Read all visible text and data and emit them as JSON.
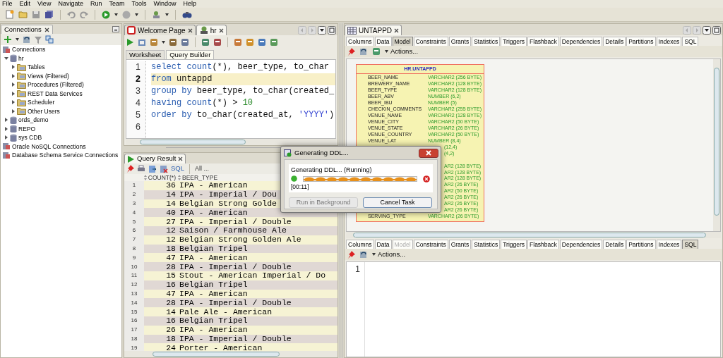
{
  "menu": [
    "File",
    "Edit",
    "View",
    "Navigate",
    "Run",
    "Team",
    "Tools",
    "Window",
    "Help"
  ],
  "connections_panel": {
    "tab": "Connections",
    "tree": [
      {
        "label": "Connections",
        "kind": "group"
      },
      {
        "label": "hr",
        "kind": "connection",
        "expanded": true,
        "children": [
          {
            "label": "Tables",
            "kind": "folder",
            "expanded": false
          },
          {
            "label": "Views (Filtered)",
            "kind": "folder",
            "expanded": false
          },
          {
            "label": "Procedures (Filtered)",
            "kind": "folder",
            "expanded": false
          },
          {
            "label": "REST Data Services",
            "kind": "folder",
            "expanded": false
          },
          {
            "label": "Scheduler",
            "kind": "folder",
            "expanded": false
          },
          {
            "label": "Other Users",
            "kind": "folder",
            "expanded": false
          }
        ]
      },
      {
        "label": "ords_demo",
        "kind": "connection",
        "expanded": false
      },
      {
        "label": "REPO",
        "kind": "connection",
        "expanded": false
      },
      {
        "label": "sys CDB",
        "kind": "connection",
        "expanded": false
      },
      {
        "label": "Oracle NoSQL Connections",
        "kind": "group"
      },
      {
        "label": "Database Schema Service Connections",
        "kind": "group"
      }
    ]
  },
  "editor": {
    "tabs": [
      {
        "label": "Welcome Page",
        "selected": false
      },
      {
        "label": "hr",
        "selected": true
      }
    ],
    "sheet_tabs": [
      {
        "label": "Worksheet",
        "selected": true
      },
      {
        "label": "Query Builder",
        "selected": false
      }
    ],
    "lines": [
      {
        "number": "1",
        "current": false,
        "tokens": [
          {
            "t": "select count",
            "kind": "keyword"
          },
          {
            "t": "(*), beer_type, to_char",
            "kind": "plain"
          }
        ]
      },
      {
        "number": "2",
        "current": true,
        "tokens": [
          {
            "t": "from",
            "kind": "keyword"
          },
          {
            "t": " untappd",
            "kind": "plain"
          }
        ]
      },
      {
        "number": "3",
        "current": false,
        "tokens": [
          {
            "t": "group by",
            "kind": "keyword"
          },
          {
            "t": " beer_type, to_char(created_",
            "kind": "plain"
          }
        ]
      },
      {
        "number": "4",
        "current": false,
        "tokens": [
          {
            "t": "having count",
            "kind": "keyword"
          },
          {
            "t": "(*) > ",
            "kind": "plain"
          },
          {
            "t": "10",
            "kind": "number"
          }
        ]
      },
      {
        "number": "5",
        "current": false,
        "tokens": [
          {
            "t": "order by",
            "kind": "keyword"
          },
          {
            "t": " to_char(created_at, ",
            "kind": "plain"
          },
          {
            "t": "'YYYY'",
            "kind": "string"
          },
          {
            "t": ")",
            "kind": "plain"
          }
        ]
      },
      {
        "number": "6",
        "current": false
      }
    ]
  },
  "query_result": {
    "tab": "Query Result",
    "sql_link": "SQL",
    "fetch_label": "All ...",
    "columns": [
      "COUNT(*)",
      "BEER_TYPE"
    ],
    "rows": [
      {
        "n": "1",
        "count": "36",
        "beer_type": "IPA - American"
      },
      {
        "n": "2",
        "count": "14",
        "beer_type": "IPA - Imperial / Dou"
      },
      {
        "n": "3",
        "count": "14",
        "beer_type": "Belgian Strong Golde"
      },
      {
        "n": "4",
        "count": "40",
        "beer_type": "IPA - American"
      },
      {
        "n": "5",
        "count": "27",
        "beer_type": "IPA - Imperial / Double"
      },
      {
        "n": "6",
        "count": "12",
        "beer_type": "Saison / Farmhouse Ale"
      },
      {
        "n": "7",
        "count": "12",
        "beer_type": "Belgian Strong Golden Ale"
      },
      {
        "n": "8",
        "count": "18",
        "beer_type": "Belgian Tripel"
      },
      {
        "n": "9",
        "count": "47",
        "beer_type": "IPA - American"
      },
      {
        "n": "10",
        "count": "28",
        "beer_type": "IPA - Imperial / Double"
      },
      {
        "n": "11",
        "count": "15",
        "beer_type": "Stout - American Imperial / Do"
      },
      {
        "n": "12",
        "count": "16",
        "beer_type": "Belgian Tripel"
      },
      {
        "n": "13",
        "count": "47",
        "beer_type": "IPA - American"
      },
      {
        "n": "14",
        "count": "28",
        "beer_type": "IPA - Imperial / Double"
      },
      {
        "n": "15",
        "count": "14",
        "beer_type": "Pale Ale - American"
      },
      {
        "n": "16",
        "count": "16",
        "beer_type": "Belgian Tripel"
      },
      {
        "n": "17",
        "count": "26",
        "beer_type": "IPA - American"
      },
      {
        "n": "18",
        "count": "18",
        "beer_type": "IPA - Imperial / Double"
      },
      {
        "n": "19",
        "count": "24",
        "beer_type": "Porter - American"
      }
    ]
  },
  "table_panel": {
    "tab": "UNTAPPD",
    "top_tabs": [
      {
        "label": "Columns",
        "selected": false,
        "disabled": false
      },
      {
        "label": "Data",
        "selected": false,
        "disabled": false
      },
      {
        "label": "Model",
        "selected": true,
        "disabled": false
      },
      {
        "label": "Constraints",
        "selected": false,
        "disabled": false
      },
      {
        "label": "Grants",
        "selected": false,
        "disabled": false
      },
      {
        "label": "Statistics",
        "selected": false,
        "disabled": false
      },
      {
        "label": "Triggers",
        "selected": false,
        "disabled": false
      },
      {
        "label": "Flashback",
        "selected": false,
        "disabled": false
      },
      {
        "label": "Dependencies",
        "selected": false,
        "disabled": false
      },
      {
        "label": "Details",
        "selected": false,
        "disabled": false
      },
      {
        "label": "Partitions",
        "selected": false,
        "disabled": false
      },
      {
        "label": "Indexes",
        "selected": false,
        "disabled": false
      },
      {
        "label": "SQL",
        "selected": false,
        "disabled": false
      }
    ],
    "actions": "Actions...",
    "entity": {
      "title": "HR.UNTAPPD",
      "rows": [
        {
          "kind": "full",
          "name": "BEER_NAME",
          "type": "VARCHAR2 (256 BYTE)"
        },
        {
          "kind": "full",
          "name": "BREWERY_NAME",
          "type": "VARCHAR2 (128 BYTE)"
        },
        {
          "kind": "full",
          "name": "BEER_TYPE",
          "type": "VARCHAR2 (128 BYTE)"
        },
        {
          "kind": "full",
          "name": "BEER_ABV",
          "type": "NUMBER (6,2)"
        },
        {
          "kind": "full",
          "name": "BEER_IBU",
          "type": "NUMBER (5)"
        },
        {
          "kind": "full",
          "name": "CHECKIN_COMMENTS",
          "type": "VARCHAR2 (255 BYTE)"
        },
        {
          "kind": "full",
          "name": "VENUE_NAME",
          "type": "VARCHAR2 (128 BYTE)"
        },
        {
          "kind": "full",
          "name": "VENUE_CITY",
          "type": "VARCHAR2 (50 BYTE)"
        },
        {
          "kind": "full",
          "name": "VENUE_STATE",
          "type": "VARCHAR2 (26 BYTE)"
        },
        {
          "kind": "full",
          "name": "VENUE_COUNTRY",
          "type": "VARCHAR2 (50 BYTE)"
        },
        {
          "kind": "full",
          "name": "VENUE_LAT",
          "type": "NUMBER (8,4)"
        },
        {
          "kind": "partial",
          "type": "(12,4)"
        },
        {
          "kind": "partial",
          "type": "(4,2)"
        },
        {
          "kind": "covered"
        },
        {
          "kind": "partial",
          "type": "AR2 (128 BYTE)"
        },
        {
          "kind": "partial",
          "type": "AR2 (128 BYTE)"
        },
        {
          "kind": "partial",
          "type": "AR2 (128 BYTE)"
        },
        {
          "kind": "partial",
          "type": "AR2 (26 BYTE)"
        },
        {
          "kind": "partial",
          "type": "AR2 (50 BYTE)"
        },
        {
          "kind": "partial",
          "type": "AR2 (26 BYTE)"
        },
        {
          "kind": "partial",
          "type": "AR2 (26 BYTE)"
        },
        {
          "kind": "partial",
          "type": "AR2 (26 BYTE)"
        },
        {
          "kind": "full",
          "name": "SERVING_TYPE",
          "type": "VARCHAR2 (26 BYTE)"
        }
      ]
    },
    "bottom_tabs": [
      {
        "label": "Columns",
        "selected": false,
        "disabled": false
      },
      {
        "label": "Data",
        "selected": false,
        "disabled": false
      },
      {
        "label": "Model",
        "selected": false,
        "disabled": true
      },
      {
        "label": "Constraints",
        "selected": false,
        "disabled": false
      },
      {
        "label": "Grants",
        "selected": false,
        "disabled": false
      },
      {
        "label": "Statistics",
        "selected": false,
        "disabled": false
      },
      {
        "label": "Triggers",
        "selected": false,
        "disabled": false
      },
      {
        "label": "Flashback",
        "selected": false,
        "disabled": false
      },
      {
        "label": "Dependencies",
        "selected": false,
        "disabled": false
      },
      {
        "label": "Details",
        "selected": false,
        "disabled": false
      },
      {
        "label": "Partitions",
        "selected": false,
        "disabled": false
      },
      {
        "label": "Indexes",
        "selected": false,
        "disabled": false
      },
      {
        "label": "SQL",
        "selected": true,
        "disabled": false
      }
    ],
    "bottom_actions": "Actions...",
    "sql_line_numbers": [
      "1"
    ]
  },
  "dialog": {
    "title": "Generating DDL...",
    "status": "Generating DDL... (Running)",
    "elapsed": "[00:11]",
    "buttons": [
      {
        "label": "Run in Background",
        "disabled": true
      },
      {
        "label": "Cancel Task",
        "disabled": false
      }
    ]
  }
}
